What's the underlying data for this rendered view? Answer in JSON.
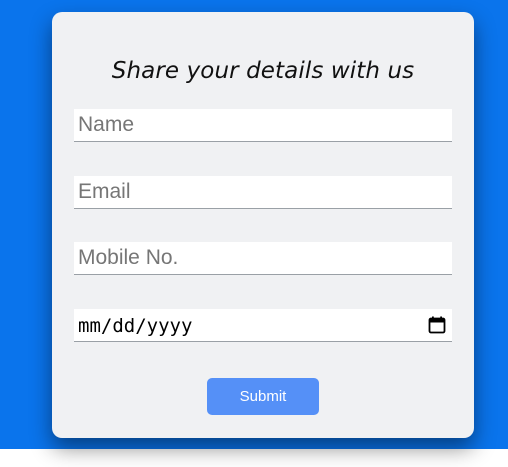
{
  "form": {
    "title": "Share your details with us",
    "fields": [
      {
        "name": "name",
        "placeholder": "Name",
        "value": ""
      },
      {
        "name": "email",
        "placeholder": "Email",
        "value": ""
      },
      {
        "name": "mobile",
        "placeholder": "Mobile No.",
        "value": ""
      },
      {
        "name": "date",
        "placeholder": "mm/dd/yyyy",
        "value": "",
        "icon": "calendar-icon"
      }
    ],
    "submit_label": "Submit"
  },
  "colors": {
    "background": "#0a74ec",
    "card": "#f0f1f3",
    "button": "#5590f7",
    "button_text": "#ffffff"
  }
}
